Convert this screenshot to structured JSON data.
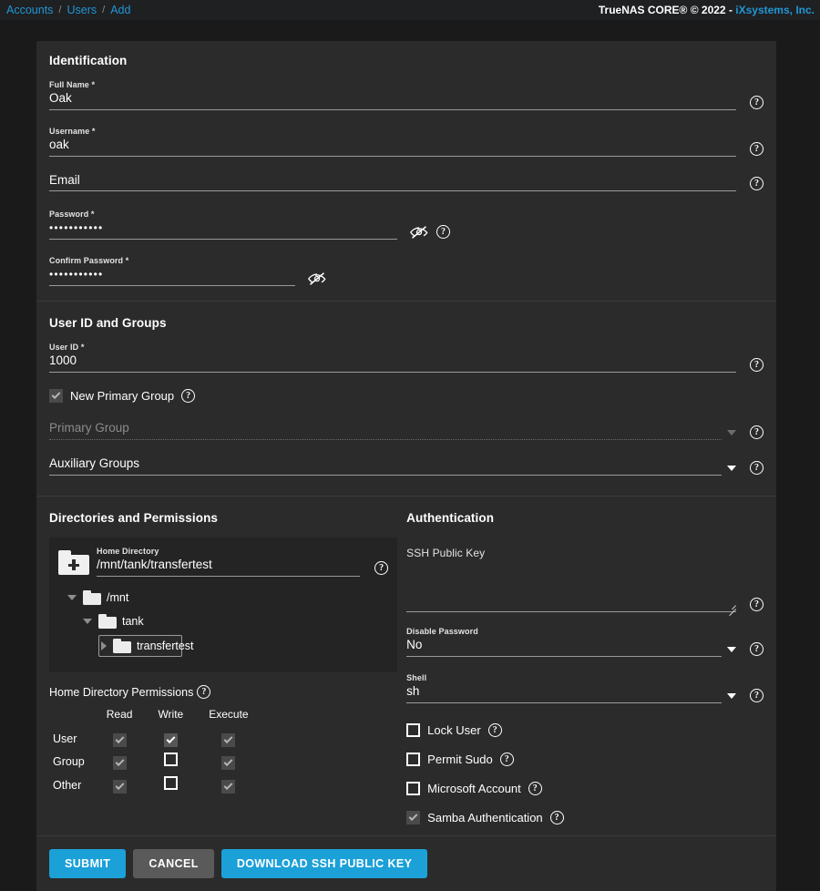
{
  "topbar": {
    "breadcrumb": [
      "Accounts",
      "Users",
      "Add"
    ],
    "separator": "/",
    "copyright_prefix": "TrueNAS CORE® © 2022 - ",
    "vendor": "iXsystems, Inc.",
    "accent_color": "#2196d4"
  },
  "help_glyph": "?",
  "identification": {
    "title": "Identification",
    "full_name": {
      "label": "Full Name *",
      "value": "Oak"
    },
    "username": {
      "label": "Username *",
      "value": "oak"
    },
    "email": {
      "label": "Email",
      "value": ""
    },
    "password": {
      "label": "Password *",
      "value": "•••••••••••"
    },
    "confirm_password": {
      "label": "Confirm Password *",
      "value": "•••••••••••"
    }
  },
  "user_id_groups": {
    "title": "User ID and Groups",
    "user_id": {
      "label": "User ID *",
      "value": "1000"
    },
    "new_primary_group": {
      "label": "New Primary Group",
      "checked": true
    },
    "primary_group": {
      "label": "Primary Group",
      "value": "",
      "disabled": true
    },
    "auxiliary_groups": {
      "label": "Auxiliary Groups",
      "value": ""
    }
  },
  "directories": {
    "title": "Directories and Permissions",
    "home_directory": {
      "label": "Home Directory",
      "value": "/mnt/tank/transfertest"
    },
    "tree": [
      {
        "label": "/mnt",
        "depth": 0,
        "expanded": true,
        "selected": false
      },
      {
        "label": "tank",
        "depth": 1,
        "expanded": true,
        "selected": false
      },
      {
        "label": "transfertest",
        "depth": 2,
        "expanded": false,
        "selected": true
      }
    ],
    "permissions": {
      "title": "Home Directory Permissions",
      "columns": [
        "Read",
        "Write",
        "Execute"
      ],
      "rows": [
        {
          "label": "User",
          "read": "checked-dim",
          "write": "checked-bright",
          "execute": "checked-dim"
        },
        {
          "label": "Group",
          "read": "checked-dim",
          "write": "unchecked",
          "execute": "checked-dim"
        },
        {
          "label": "Other",
          "read": "checked-dim",
          "write": "unchecked",
          "execute": "checked-dim"
        }
      ]
    }
  },
  "authentication": {
    "title": "Authentication",
    "ssh_public_key": {
      "label": "SSH Public Key",
      "value": ""
    },
    "disable_password": {
      "label": "Disable Password",
      "value": "No"
    },
    "shell": {
      "label": "Shell",
      "value": "sh"
    },
    "checkboxes": [
      {
        "label": "Lock User",
        "state": "unchecked"
      },
      {
        "label": "Permit Sudo",
        "state": "unchecked"
      },
      {
        "label": "Microsoft Account",
        "state": "unchecked"
      },
      {
        "label": "Samba Authentication",
        "state": "checked-dim"
      }
    ]
  },
  "actions": {
    "submit": "SUBMIT",
    "cancel": "CANCEL",
    "download": "DOWNLOAD SSH PUBLIC KEY"
  }
}
